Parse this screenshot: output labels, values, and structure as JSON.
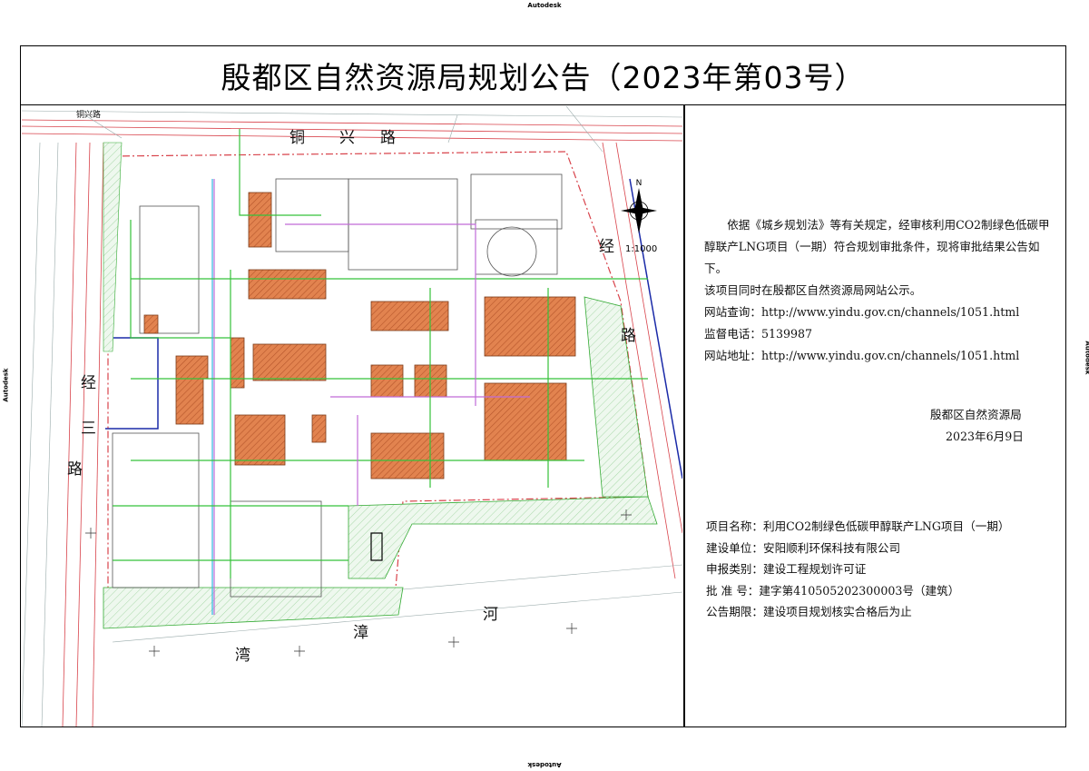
{
  "watermark": "Autodesk",
  "title": "殷都区自然资源局规划公告（2023年第03号）",
  "notice": {
    "paragraph1": "依据《城乡规划法》等有关规定，经审核利用CO2制绿色低碳甲醇联产LNG项目（一期）符合规划审批条件，现将审批结果公告如下。",
    "paragraph2": "该项目同时在殷都区自然资源局网站公示。",
    "website_query": "网站查询：http://www.yindu.gov.cn/channels/1051.html",
    "hotline": "监督电话：5139987",
    "website_address": "网站地址：http://www.yindu.gov.cn/channels/1051.html"
  },
  "signer": "殷都区自然资源局",
  "date": "2023年6月9日",
  "project_info": [
    {
      "label": "项目名称：",
      "value": "利用CO2制绿色低碳甲醇联产LNG项目（一期）"
    },
    {
      "label": "建设单位：",
      "value": "安阳顺利环保科技有限公司"
    },
    {
      "label": "申报类别：",
      "value": "建设工程规划许可证"
    },
    {
      "label": "批 准 号：",
      "value": "建字第410505202300003号（建筑）"
    },
    {
      "label": "公告期限：",
      "value": "建设项目规划核实合格后为止"
    }
  ],
  "map": {
    "scale": "1:1000",
    "north": "N",
    "road_top": [
      "铜",
      "兴",
      "路"
    ],
    "road_top_small": "铜兴路",
    "road_left": [
      "经",
      "三",
      "路"
    ],
    "road_right": [
      "经",
      "路"
    ],
    "river": [
      "漳",
      "河",
      "湾"
    ]
  }
}
